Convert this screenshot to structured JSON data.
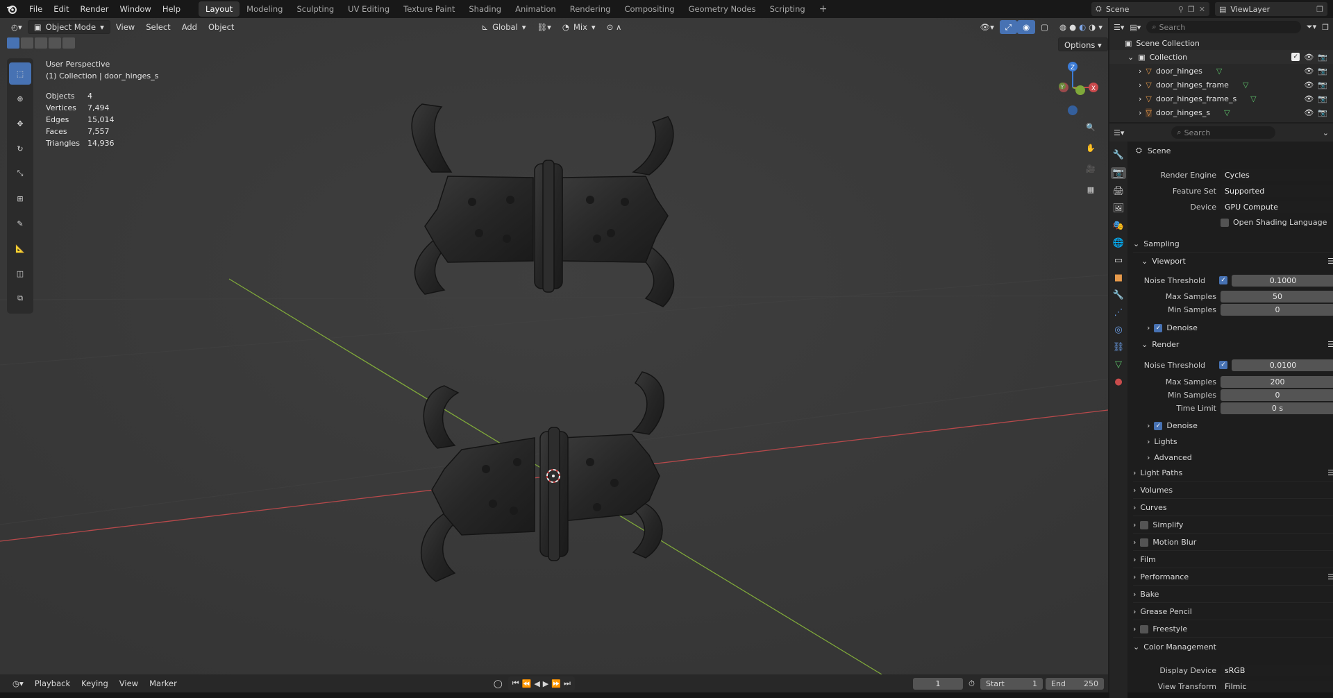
{
  "topbar": {
    "menus": [
      "File",
      "Edit",
      "Render",
      "Window",
      "Help"
    ],
    "workspaces": [
      "Layout",
      "Modeling",
      "Sculpting",
      "UV Editing",
      "Texture Paint",
      "Shading",
      "Animation",
      "Rendering",
      "Compositing",
      "Geometry Nodes",
      "Scripting"
    ],
    "active_workspace": "Layout",
    "scene": "Scene",
    "view_layer": "ViewLayer"
  },
  "viewport_header": {
    "mode": "Object Mode",
    "menus": [
      "View",
      "Select",
      "Add",
      "Object"
    ],
    "orientation": "Global",
    "snap_mode": "Mix",
    "options": "Options"
  },
  "overlay": {
    "perspective": "User Perspective",
    "collection_line": "(1) Collection | door_hinges_s",
    "stats": [
      {
        "label": "Objects",
        "value": "4"
      },
      {
        "label": "Vertices",
        "value": "7,494"
      },
      {
        "label": "Edges",
        "value": "15,014"
      },
      {
        "label": "Faces",
        "value": "7,557"
      },
      {
        "label": "Triangles",
        "value": "14,936"
      }
    ]
  },
  "gizmo": {
    "x": "X",
    "y": "Y",
    "z": "Z"
  },
  "timeline": {
    "menus": [
      "Playback",
      "Keying",
      "View",
      "Marker"
    ],
    "current_frame": "1",
    "start_label": "Start",
    "start": "1",
    "end_label": "End",
    "end": "250"
  },
  "outliner": {
    "search_placeholder": "Search",
    "root": "Scene Collection",
    "collection": "Collection",
    "objects": [
      "door_hinges",
      "door_hinges_frame",
      "door_hinges_frame_s",
      "door_hinges_s"
    ]
  },
  "properties": {
    "search_placeholder": "Search",
    "context": "Scene",
    "render_engine_label": "Render Engine",
    "render_engine": "Cycles",
    "feature_set_label": "Feature Set",
    "feature_set": "Supported",
    "device_label": "Device",
    "device": "GPU Compute",
    "osl_label": "Open Shading Language",
    "sampling": "Sampling",
    "viewport": "Viewport",
    "noise_threshold_label": "Noise Threshold",
    "vp_noise": "0.1000",
    "max_samples_label": "Max Samples",
    "vp_max": "50",
    "min_samples_label": "Min Samples",
    "vp_min": "0",
    "denoise": "Denoise",
    "render": "Render",
    "r_noise": "0.0100",
    "r_max": "200",
    "r_min": "0",
    "time_limit_label": "Time Limit",
    "r_time": "0 s",
    "lights": "Lights",
    "advanced": "Advanced",
    "sections": [
      "Light Paths",
      "Volumes",
      "Curves",
      "Simplify",
      "Motion Blur",
      "Film",
      "Performance",
      "Bake",
      "Grease Pencil",
      "Freestyle",
      "Color Management"
    ],
    "display_device_label": "Display Device",
    "display_device": "sRGB",
    "view_transform_label": "View Transform",
    "view_transform": "Filmic"
  },
  "colors": {
    "accent": "#4772b3",
    "x_axis": "#c9494c",
    "y_axis": "#7fa83a",
    "z_axis": "#3b7bd6"
  }
}
